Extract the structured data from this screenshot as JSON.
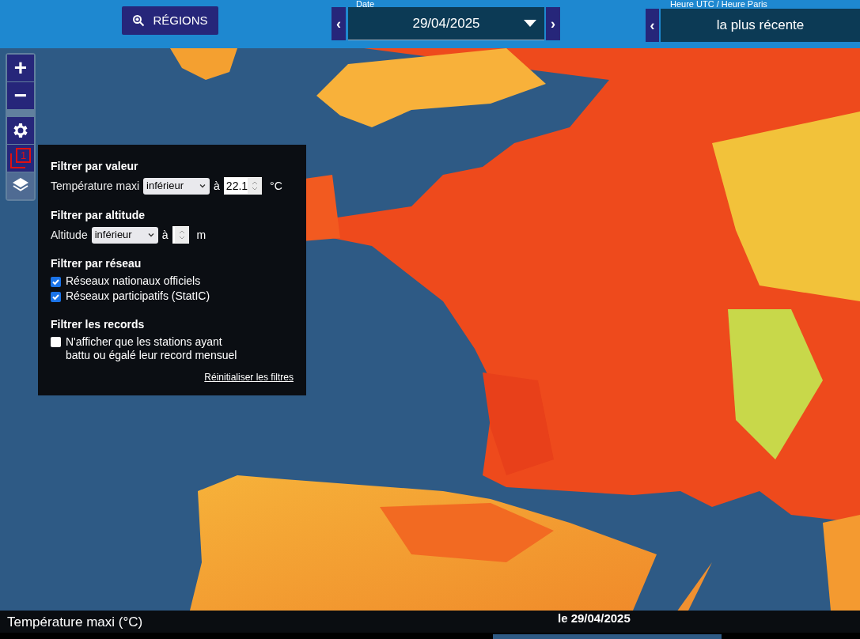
{
  "toolbar": {
    "regions_button": "RÉGIONS",
    "date": {
      "label": "Date",
      "value": "29/04/2025",
      "prev": "‹",
      "next": "›"
    },
    "time": {
      "label": "Heure UTC / Heure Paris",
      "value": "la plus récente",
      "prev": "‹"
    }
  },
  "map": {
    "kind": "picture",
    "controls": [
      {
        "kind": "zoom-in",
        "label": "+"
      },
      {
        "kind": "zoom-out",
        "label": "−"
      },
      {
        "kind": "settings"
      },
      {
        "kind": "compare",
        "badge": "1"
      },
      {
        "kind": "layers",
        "selected": true
      }
    ]
  },
  "filter_panel": {
    "value_filter": {
      "title": "Filtrer par valeur",
      "label": "Température maxi",
      "operator": "inférieur",
      "connector": "à",
      "value": "22.1",
      "unit": "°C"
    },
    "altitude_filter": {
      "title": "Filtrer par altitude",
      "label": "Altitude",
      "operator": "inférieur",
      "connector": "à",
      "unit": "m"
    },
    "network_filter": {
      "title": "Filtrer par réseau",
      "options": [
        {
          "label": "Réseaux nationaux officiels",
          "checked": true
        },
        {
          "label": "Réseaux participatifs (StatIC)",
          "checked": true
        }
      ]
    },
    "records_filter": {
      "title": "Filtrer les records",
      "options": [
        {
          "label": "N'afficher que les stations ayant battu ou égalé leur record mensuel",
          "checked": false
        }
      ]
    },
    "reset_link": "Réinitialiser les filtres"
  },
  "footer": {
    "legend": "Température maxi (°C)",
    "date": "le 29/04/2025"
  }
}
